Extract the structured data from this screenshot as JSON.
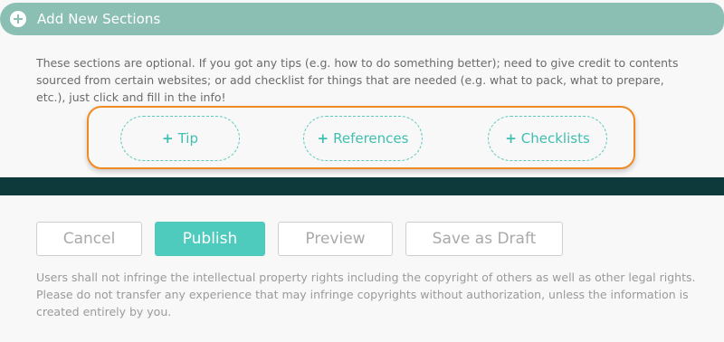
{
  "section": {
    "title": "Add New Sections",
    "icon": "plus-circle-icon",
    "description": "These sections are optional. If you got any tips (e.g. how to do something better); need to give credit to contents sourced from certain websites; or add checklist for things that are needed (e.g. what to pack, what to prepare, etc.), just click and fill in the info!"
  },
  "options": [
    {
      "plus": "+",
      "label": "Tip"
    },
    {
      "plus": "+",
      "label": "References"
    },
    {
      "plus": "+",
      "label": "Checklists"
    }
  ],
  "actions": {
    "cancel": "Cancel",
    "publish": "Publish",
    "preview": "Preview",
    "save_draft": "Save as Draft"
  },
  "notice": "Users shall not infringe the intellectual property rights including the copyright of others as well as other legal rights. Please do not transfer any experience that may infringe copyrights without authorization, unless the information is created entirely by you.",
  "colors": {
    "header": "#8cbfb3",
    "accent": "#4fcbbd",
    "highlight_border": "#f08a24",
    "dark_band": "#0f3a3c"
  }
}
